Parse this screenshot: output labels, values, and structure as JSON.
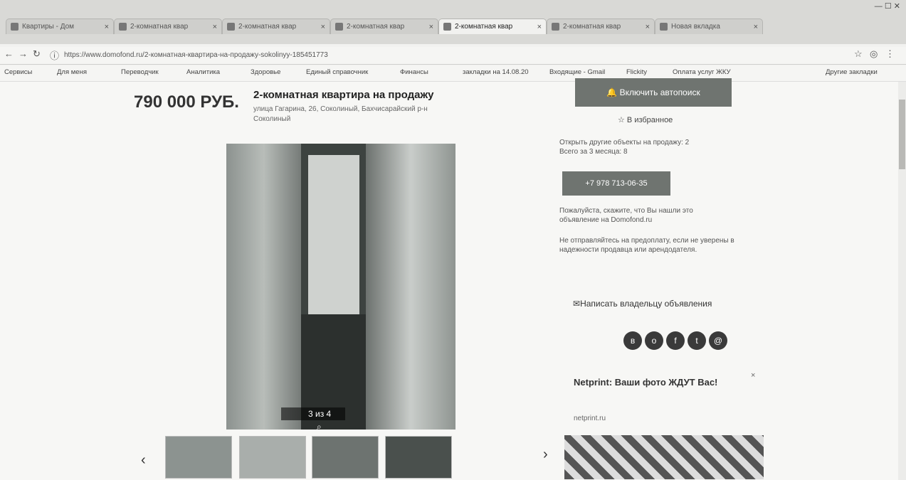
{
  "browser": {
    "tabs": [
      {
        "label": "Квартиры - Дом"
      },
      {
        "label": "2-комнатная квар"
      },
      {
        "label": "2-комнатная квар"
      },
      {
        "label": "2-комнатная квар"
      },
      {
        "label": "2-комнатная квар"
      },
      {
        "label": "2-комнатная квар"
      },
      {
        "label": "Новая вкладка"
      }
    ],
    "active_tab": 4,
    "url": "https://www.domofond.ru/2-комнатная-квартира-на-продажу-sokolinyy-185451773",
    "bookmarks": [
      "Сервисы",
      "Для меня",
      "Переводчик",
      "Аналитика",
      "Здоровье",
      "Единый справочник",
      "Финансы",
      "закладки на 14.08.20",
      "Входящие - Gmail",
      "Flickity",
      "Оплата услуг ЖКУ",
      "Другие закладки"
    ]
  },
  "listing": {
    "price": "790 000 РУБ.",
    "title": "2-комнатная квартира на продажу",
    "address": "улица Гагарина, 26, Соколиный, Бахчисарайский р-н",
    "address2": "Соколиный",
    "photo_counter": "3 из 4",
    "thumb_count": 4
  },
  "sidebar": {
    "autoalert_button": "Включить автопоиск",
    "favorite_label": "В избранное",
    "similar_text": "Открыть другие объекты на продажу: 2",
    "similar_text2": "Всего за 3 месяца: 8",
    "phone_button": "+7 978 713-06-35",
    "note1": "Пожалуйста, скажите, что Вы нашли это объявление на Domofond.ru",
    "note2": "Не отправляйтесь на предоплату, если не уверены в надежности продавца или арендодателя.",
    "write_owner": "Написать владельцу объявления"
  },
  "ad": {
    "title": "Netprint: Ваши фото ЖДУТ Вас!",
    "url": "netprint.ru",
    "close": "×"
  },
  "colors": {
    "accent": "#6f7470",
    "page_bg": "#f7f7f5"
  }
}
